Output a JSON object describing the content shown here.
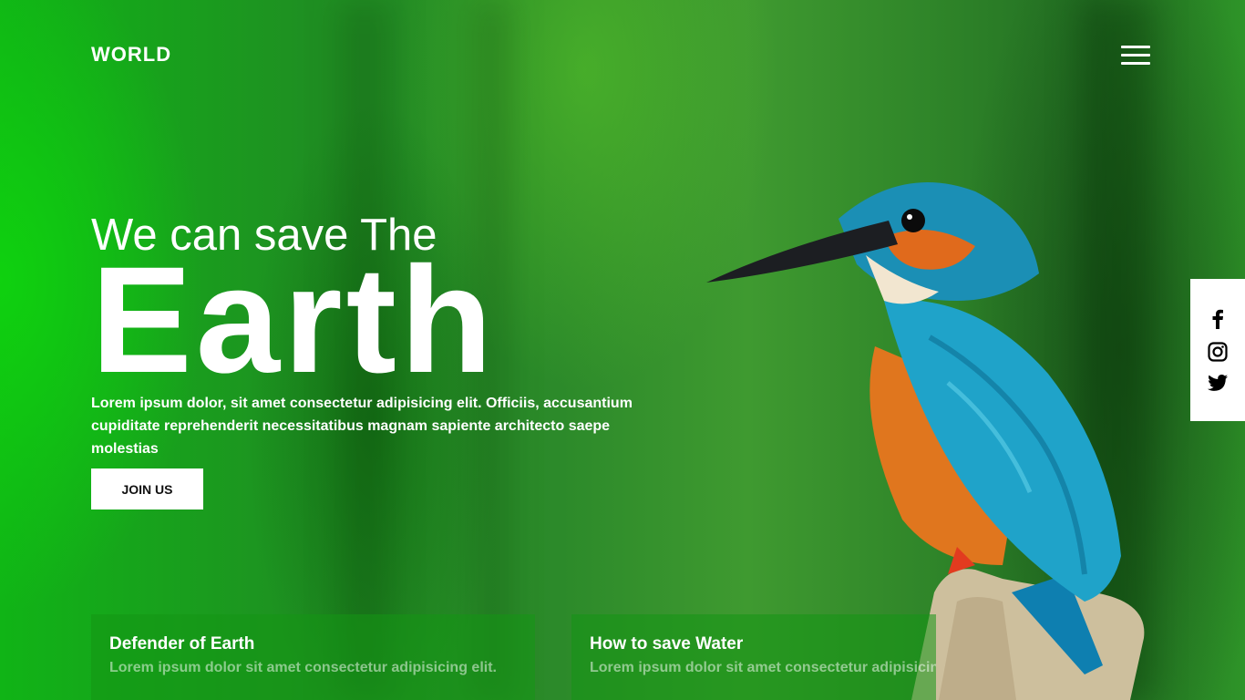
{
  "header": {
    "logo": "WORLD",
    "menu_icon": "hamburger-menu-icon"
  },
  "hero": {
    "subtitle": "We can save The",
    "title": "Earth",
    "description": "Lorem ipsum dolor, sit amet consectetur adipisicing elit. Officiis, accusantium cupiditate reprehenderit necessitatibus magnam sapiente architecto saepe molestias",
    "cta_label": "JOIN US"
  },
  "social": {
    "icons": [
      "facebook-icon",
      "instagram-icon",
      "twitter-icon"
    ]
  },
  "cards": [
    {
      "title": "Defender of Earth",
      "text": "Lorem ipsum dolor sit amet consectetur adipisicing elit."
    },
    {
      "title": "How to save Water",
      "text": "Lorem ipsum dolor sit amet consectetur adipisicing elit."
    }
  ],
  "colors": {
    "background_green": "#1f8f22",
    "accent_bright_green": "#0fd10f",
    "button_bg": "#ffffff",
    "bird_blue": "#1fa3c9",
    "bird_orange": "#e0761e"
  }
}
